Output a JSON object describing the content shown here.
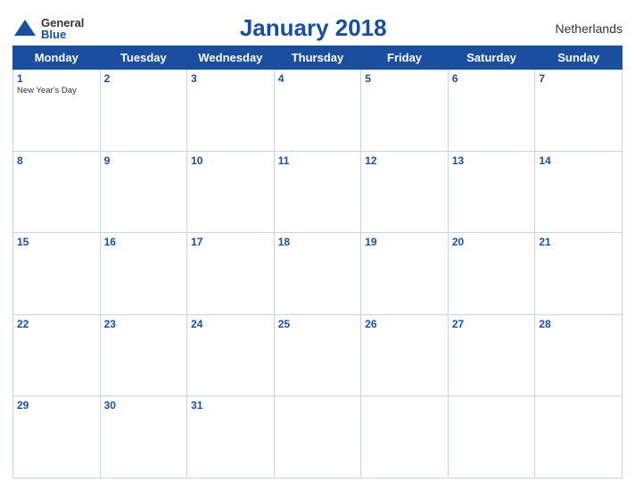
{
  "header": {
    "logo_general": "General",
    "logo_blue": "Blue",
    "title": "January 2018",
    "country": "Netherlands"
  },
  "days_of_week": [
    "Monday",
    "Tuesday",
    "Wednesday",
    "Thursday",
    "Friday",
    "Saturday",
    "Sunday"
  ],
  "weeks": [
    [
      {
        "day": "1",
        "holiday": "New Year's Day"
      },
      {
        "day": "2",
        "holiday": ""
      },
      {
        "day": "3",
        "holiday": ""
      },
      {
        "day": "4",
        "holiday": ""
      },
      {
        "day": "5",
        "holiday": ""
      },
      {
        "day": "6",
        "holiday": ""
      },
      {
        "day": "7",
        "holiday": ""
      }
    ],
    [
      {
        "day": "8",
        "holiday": ""
      },
      {
        "day": "9",
        "holiday": ""
      },
      {
        "day": "10",
        "holiday": ""
      },
      {
        "day": "11",
        "holiday": ""
      },
      {
        "day": "12",
        "holiday": ""
      },
      {
        "day": "13",
        "holiday": ""
      },
      {
        "day": "14",
        "holiday": ""
      }
    ],
    [
      {
        "day": "15",
        "holiday": ""
      },
      {
        "day": "16",
        "holiday": ""
      },
      {
        "day": "17",
        "holiday": ""
      },
      {
        "day": "18",
        "holiday": ""
      },
      {
        "day": "19",
        "holiday": ""
      },
      {
        "day": "20",
        "holiday": ""
      },
      {
        "day": "21",
        "holiday": ""
      }
    ],
    [
      {
        "day": "22",
        "holiday": ""
      },
      {
        "day": "23",
        "holiday": ""
      },
      {
        "day": "24",
        "holiday": ""
      },
      {
        "day": "25",
        "holiday": ""
      },
      {
        "day": "26",
        "holiday": ""
      },
      {
        "day": "27",
        "holiday": ""
      },
      {
        "day": "28",
        "holiday": ""
      }
    ],
    [
      {
        "day": "29",
        "holiday": ""
      },
      {
        "day": "30",
        "holiday": ""
      },
      {
        "day": "31",
        "holiday": ""
      },
      {
        "day": "",
        "holiday": ""
      },
      {
        "day": "",
        "holiday": ""
      },
      {
        "day": "",
        "holiday": ""
      },
      {
        "day": "",
        "holiday": ""
      }
    ]
  ]
}
